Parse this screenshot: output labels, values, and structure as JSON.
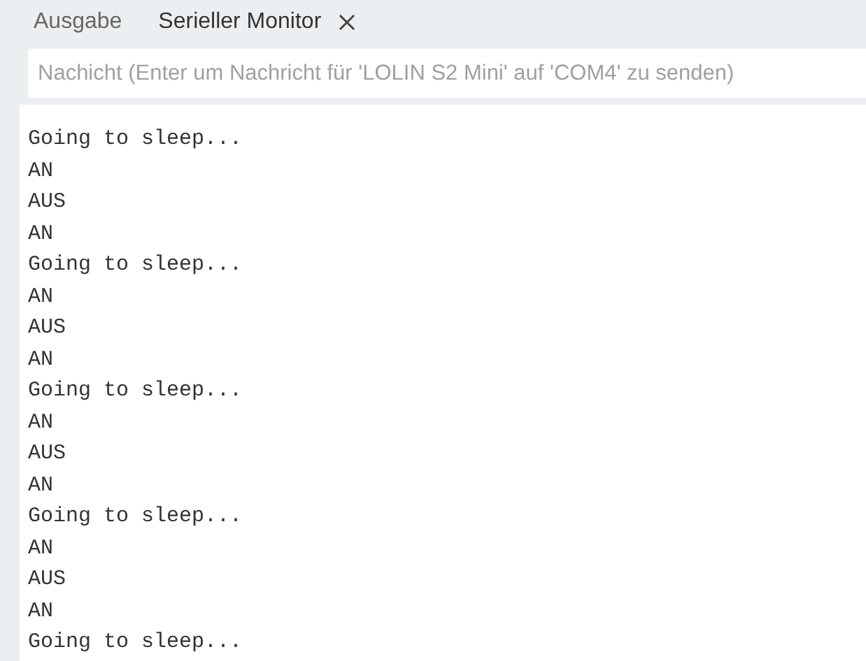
{
  "tabs": [
    {
      "label": "Ausgabe",
      "selected": false,
      "closable": false
    },
    {
      "label": "Serieller Monitor",
      "selected": true,
      "closable": true
    }
  ],
  "message_field": {
    "placeholder": "Nachicht (Enter um Nachricht für 'LOLIN S2 Mini' auf 'COM4' zu senden)"
  },
  "output_lines": [
    "Going to sleep...",
    "AN",
    "AUS",
    "AN",
    "Going to sleep...",
    "AN",
    "AUS",
    "AN",
    "Going to sleep...",
    "AN",
    "AUS",
    "AN",
    "Going to sleep...",
    "AN",
    "AUS",
    "AN",
    "Going to sleep..."
  ]
}
